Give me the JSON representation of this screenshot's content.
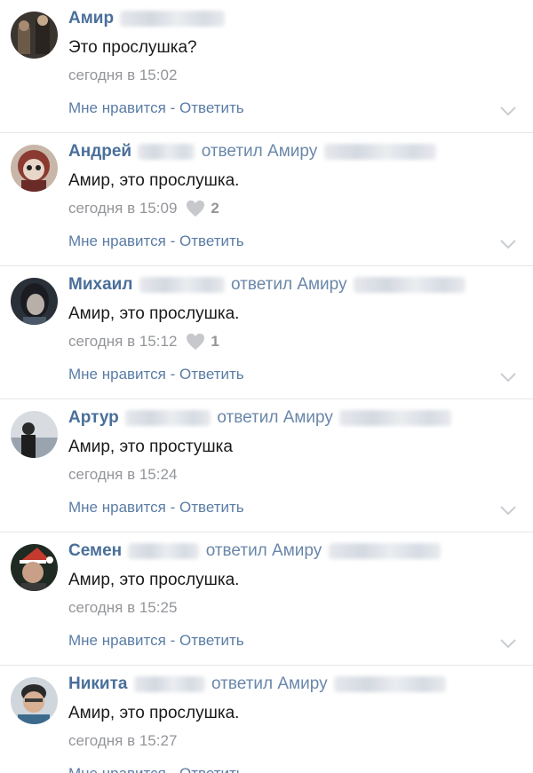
{
  "comments": [
    {
      "name": "Амир",
      "replied": "",
      "text": "Это прослушка?",
      "time": "сегодня в 15:02",
      "likes": "",
      "like_label": "Мне нравится",
      "sep": " - ",
      "reply_label": "Ответить"
    },
    {
      "name": "Андрей",
      "replied": "ответил Амиру",
      "text": "Амир, это прослушка.",
      "time": "сегодня в 15:09",
      "likes": "2",
      "like_label": "Мне нравится",
      "sep": " - ",
      "reply_label": "Ответить"
    },
    {
      "name": "Михаил",
      "replied": "ответил Амиру",
      "text": "Амир, это прослушка.",
      "time": "сегодня в 15:12",
      "likes": "1",
      "like_label": "Мне нравится",
      "sep": " - ",
      "reply_label": "Ответить"
    },
    {
      "name": "Артур",
      "replied": "ответил Амиру",
      "text": "Амир, это простушка",
      "time": "сегодня в 15:24",
      "likes": "",
      "like_label": "Мне нравится",
      "sep": " - ",
      "reply_label": "Ответить"
    },
    {
      "name": "Семен",
      "replied": "ответил Амиру",
      "text": "Амир, это прослушка.",
      "time": "сегодня в 15:25",
      "likes": "",
      "like_label": "Мне нравится",
      "sep": " - ",
      "reply_label": "Ответить"
    },
    {
      "name": "Никита",
      "replied": "ответил Амиру",
      "text": "Амир, это прослушка.",
      "time": "сегодня в 15:27",
      "likes": "",
      "like_label": "Мне нравится",
      "sep": " - ",
      "reply_label": "Ответить"
    }
  ],
  "colors": {
    "name": "#4a6f9a",
    "link": "#5a7ca5",
    "meta": "#939599",
    "divider": "#e3e6ea"
  },
  "icons": {
    "like": "heart-icon",
    "expand": "chevron-down-icon"
  }
}
